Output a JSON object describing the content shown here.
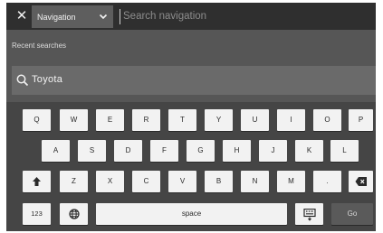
{
  "header": {
    "close_symbol": "✕",
    "dropdown_label": "Navigation",
    "search_placeholder": "Search navigation"
  },
  "recent": {
    "header": "Recent searches",
    "items": [
      {
        "label": "Toyota",
        "icon": "search-icon"
      }
    ]
  },
  "keyboard": {
    "row1": [
      "Q",
      "W",
      "E",
      "R",
      "T",
      "Y",
      "U",
      "I",
      "O",
      "P"
    ],
    "row2": [
      "A",
      "S",
      "D",
      "F",
      "G",
      "H",
      "J",
      "K",
      "L"
    ],
    "row3": [
      "Z",
      "X",
      "C",
      "V",
      "B",
      "N",
      "M",
      "."
    ],
    "numbers_label": "123",
    "space_label": "space",
    "go_label": "Go",
    "icons": {
      "shift": "shift-arrow-icon",
      "backspace": "backspace-icon",
      "language": "globe-icon",
      "hide": "keyboard-hide-icon"
    }
  },
  "colors": {
    "background": "#4a4a4a",
    "topbar": "#2f2f2f",
    "key": "#f2f2f2",
    "key_dark": "#5a5a5a"
  }
}
